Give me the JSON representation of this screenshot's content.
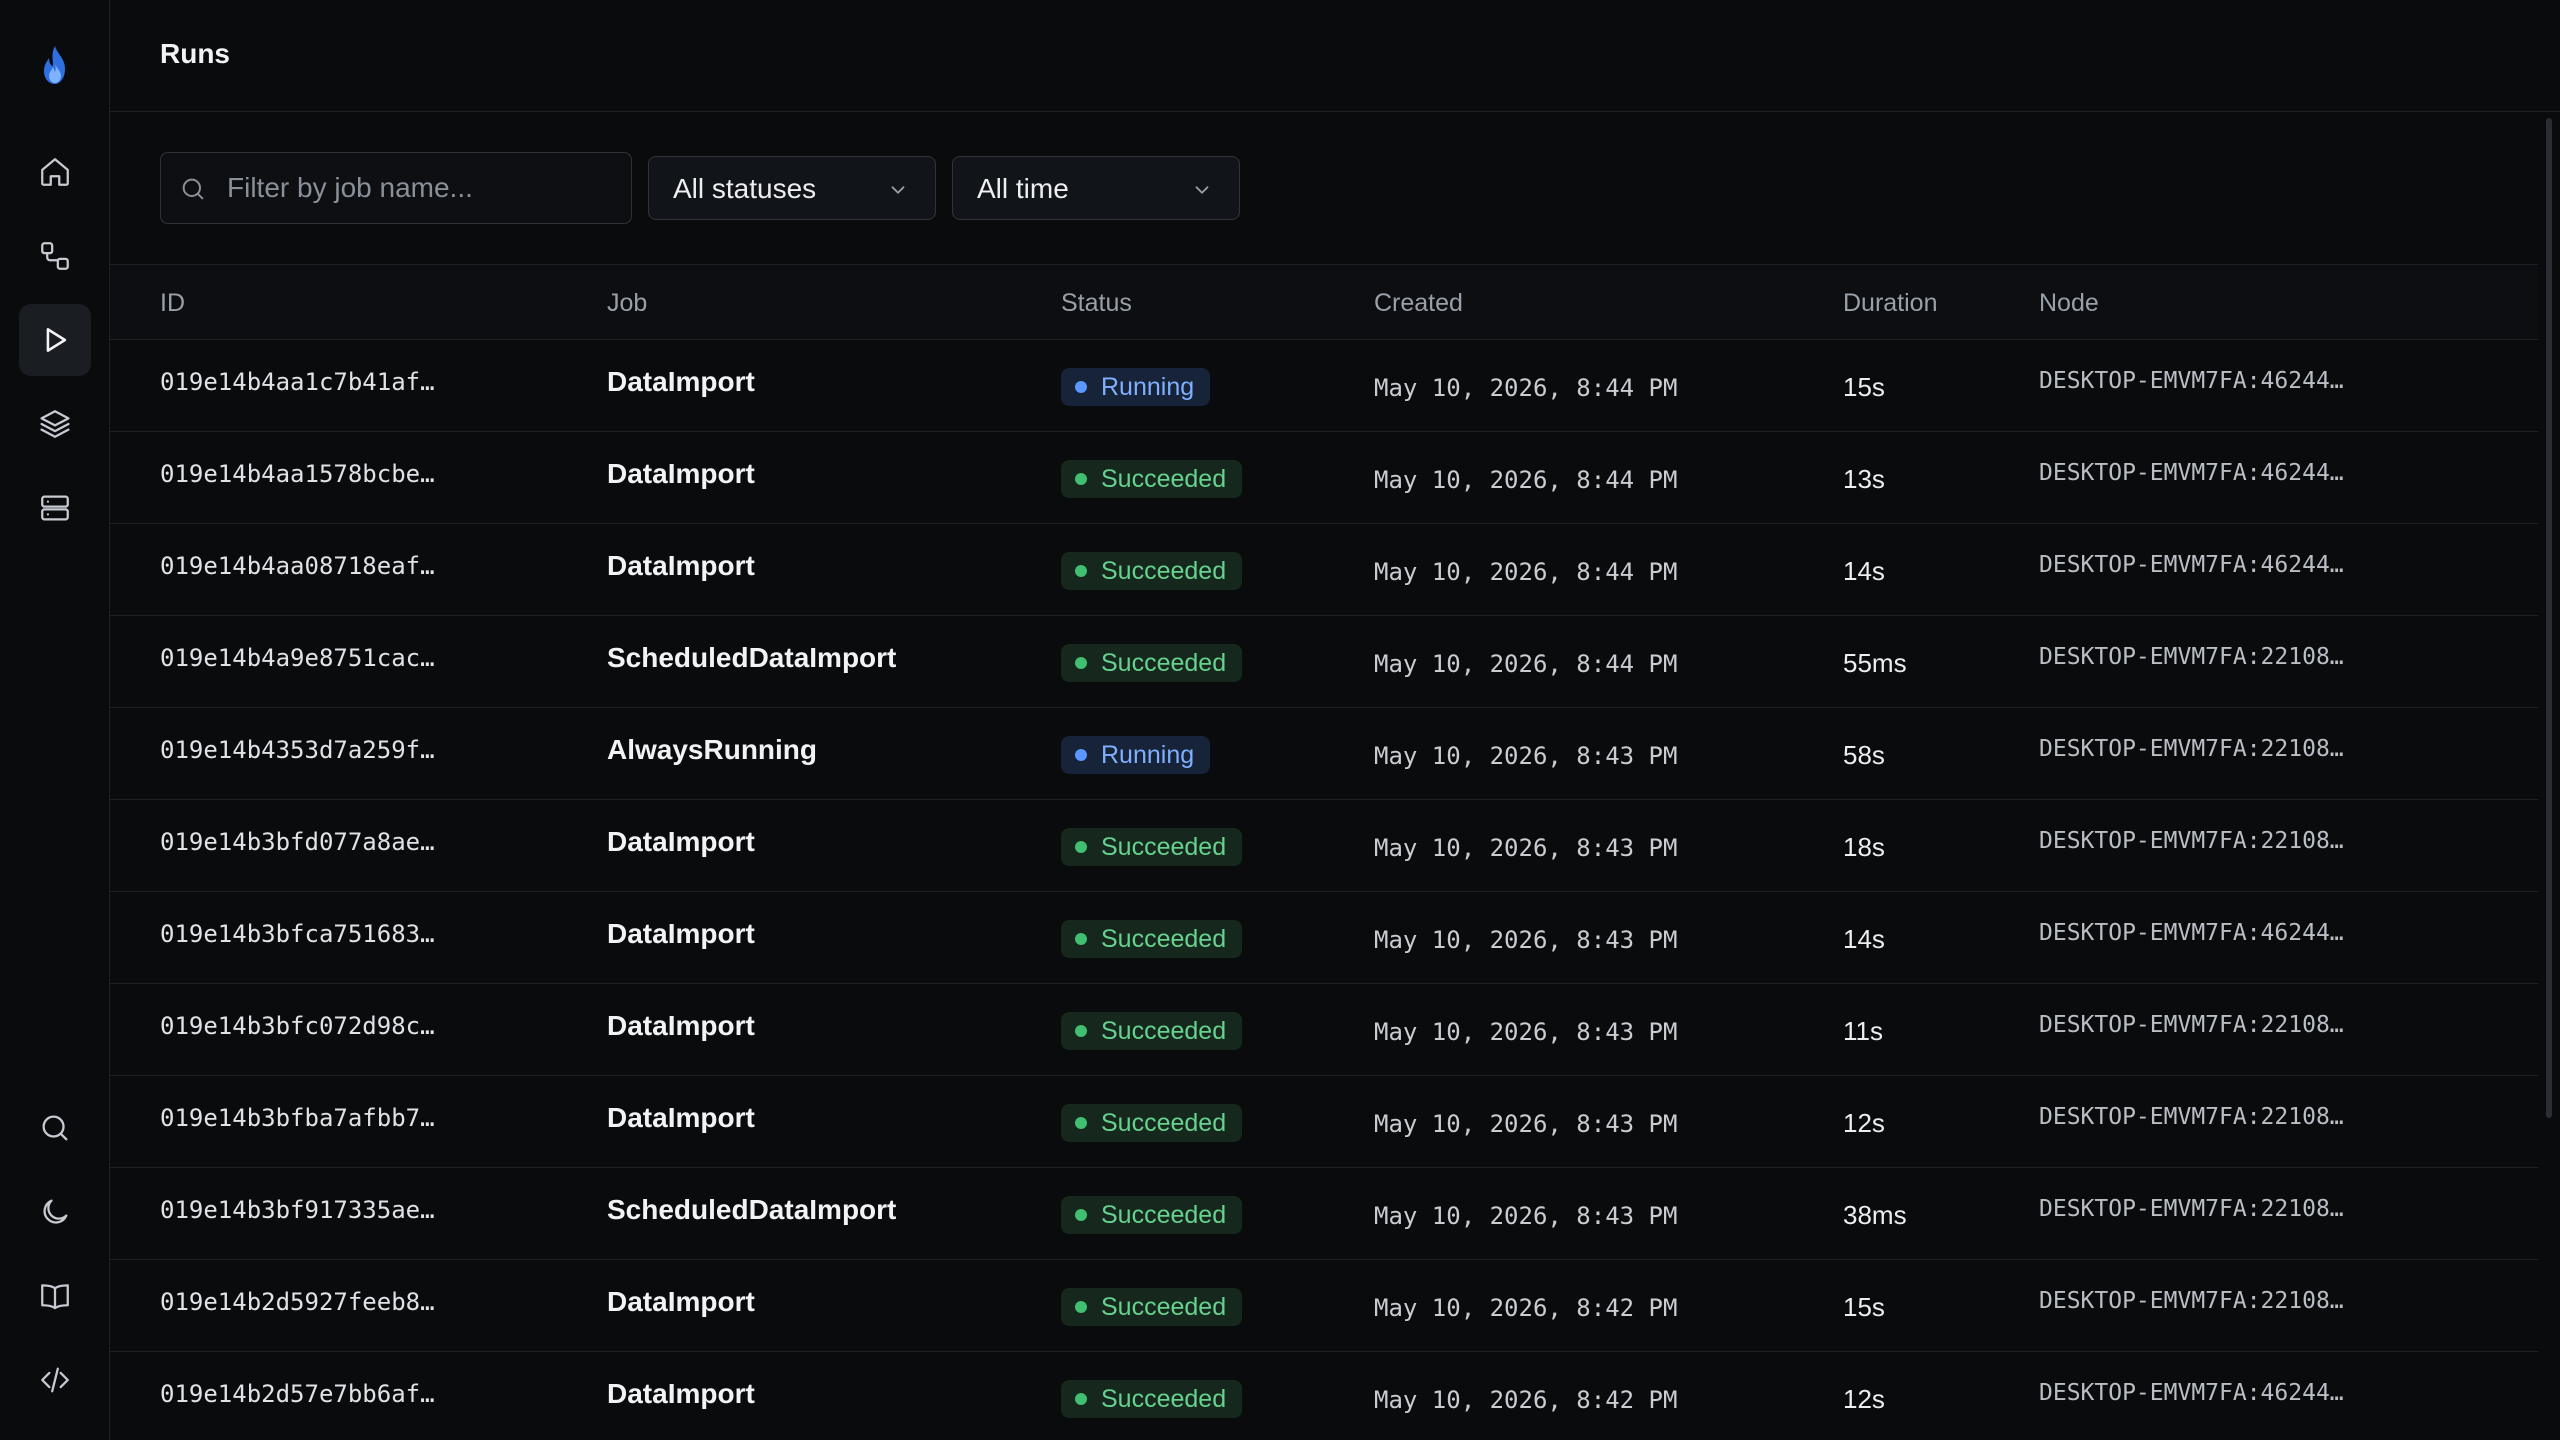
{
  "page": {
    "title": "Runs"
  },
  "sidebar": {
    "items": [
      {
        "name": "home",
        "icon": "home-icon",
        "active": false
      },
      {
        "name": "jobs",
        "icon": "workflow-icon",
        "active": false
      },
      {
        "name": "runs",
        "icon": "play-icon",
        "active": true
      },
      {
        "name": "layers",
        "icon": "layers-icon",
        "active": false
      },
      {
        "name": "servers",
        "icon": "server-icon",
        "active": false
      }
    ],
    "bottom_items": [
      {
        "name": "search",
        "icon": "search-icon"
      },
      {
        "name": "theme",
        "icon": "moon-icon"
      },
      {
        "name": "docs",
        "icon": "book-icon"
      },
      {
        "name": "api",
        "icon": "code-icon"
      }
    ]
  },
  "filters": {
    "search_placeholder": "Filter by job name...",
    "status_selected": "All statuses",
    "time_selected": "All time"
  },
  "table": {
    "columns": {
      "id": "ID",
      "job": "Job",
      "status": "Status",
      "created": "Created",
      "duration": "Duration",
      "node": "Node"
    },
    "rows": [
      {
        "id": "019e14b4aa1c7b41af…",
        "job": "DataImport",
        "status": "Running",
        "created": "May 10, 2026, 8:44 PM",
        "duration": "15s",
        "node": "DESKTOP-EMVM7FA:46244…"
      },
      {
        "id": "019e14b4aa1578bcbe…",
        "job": "DataImport",
        "status": "Succeeded",
        "created": "May 10, 2026, 8:44 PM",
        "duration": "13s",
        "node": "DESKTOP-EMVM7FA:46244…"
      },
      {
        "id": "019e14b4aa08718eaf…",
        "job": "DataImport",
        "status": "Succeeded",
        "created": "May 10, 2026, 8:44 PM",
        "duration": "14s",
        "node": "DESKTOP-EMVM7FA:46244…"
      },
      {
        "id": "019e14b4a9e8751cac…",
        "job": "ScheduledDataImport",
        "status": "Succeeded",
        "created": "May 10, 2026, 8:44 PM",
        "duration": "55ms",
        "node": "DESKTOP-EMVM7FA:22108…"
      },
      {
        "id": "019e14b4353d7a259f…",
        "job": "AlwaysRunning",
        "status": "Running",
        "created": "May 10, 2026, 8:43 PM",
        "duration": "58s",
        "node": "DESKTOP-EMVM7FA:22108…"
      },
      {
        "id": "019e14b3bfd077a8ae…",
        "job": "DataImport",
        "status": "Succeeded",
        "created": "May 10, 2026, 8:43 PM",
        "duration": "18s",
        "node": "DESKTOP-EMVM7FA:22108…"
      },
      {
        "id": "019e14b3bfca751683…",
        "job": "DataImport",
        "status": "Succeeded",
        "created": "May 10, 2026, 8:43 PM",
        "duration": "14s",
        "node": "DESKTOP-EMVM7FA:46244…"
      },
      {
        "id": "019e14b3bfc072d98c…",
        "job": "DataImport",
        "status": "Succeeded",
        "created": "May 10, 2026, 8:43 PM",
        "duration": "11s",
        "node": "DESKTOP-EMVM7FA:22108…"
      },
      {
        "id": "019e14b3bfba7afbb7…",
        "job": "DataImport",
        "status": "Succeeded",
        "created": "May 10, 2026, 8:43 PM",
        "duration": "12s",
        "node": "DESKTOP-EMVM7FA:22108…"
      },
      {
        "id": "019e14b3bf917335ae…",
        "job": "ScheduledDataImport",
        "status": "Succeeded",
        "created": "May 10, 2026, 8:43 PM",
        "duration": "38ms",
        "node": "DESKTOP-EMVM7FA:22108…"
      },
      {
        "id": "019e14b2d5927feeb8…",
        "job": "DataImport",
        "status": "Succeeded",
        "created": "May 10, 2026, 8:42 PM",
        "duration": "15s",
        "node": "DESKTOP-EMVM7FA:22108…"
      },
      {
        "id": "019e14b2d57e7bb6af…",
        "job": "DataImport",
        "status": "Succeeded",
        "created": "May 10, 2026, 8:42 PM",
        "duration": "12s",
        "node": "DESKTOP-EMVM7FA:46244…"
      }
    ]
  },
  "colors": {
    "background": "#0a0b0d",
    "border": "#1e2125",
    "accent": "#3b82f6",
    "running": "#7fb0ff",
    "succeeded": "#67d18e"
  }
}
